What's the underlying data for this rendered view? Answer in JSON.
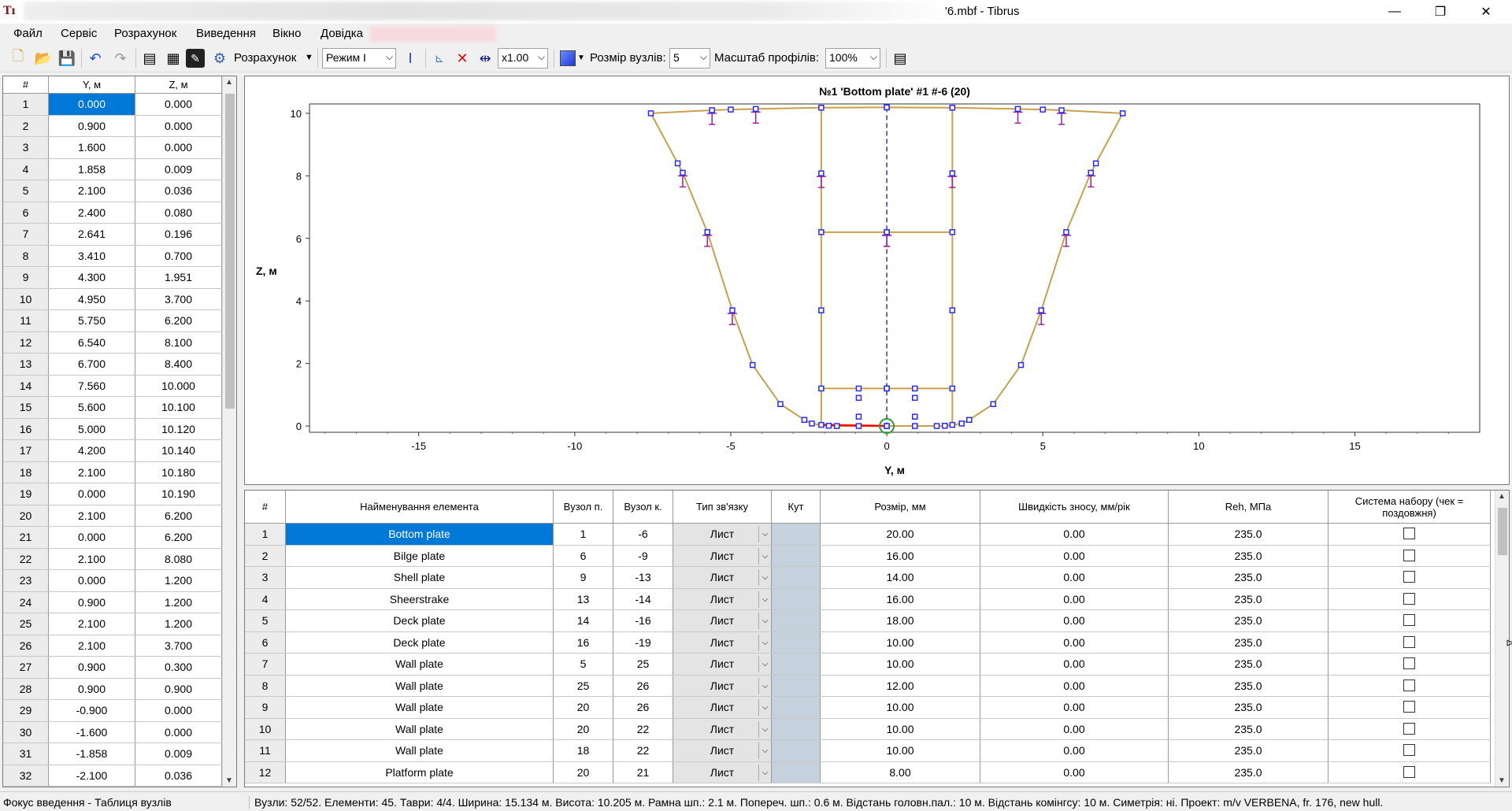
{
  "window": {
    "title": "'6.mbf - Tibrus",
    "app_icon": "tibrus-app-icon",
    "minimize": "—",
    "restore": "❐",
    "close": "✕"
  },
  "menu": [
    "Файл",
    "Сервіс",
    "Розрахунок",
    "Виведення",
    "Вікно",
    "Довідка"
  ],
  "toolbar": {
    "calc_label": "Розрахунок",
    "mode_value": "Режим I",
    "zoom_value": "x1.00",
    "node_size_label": "Розмір вузлів:",
    "node_size_value": "5",
    "profile_scale_label": "Масштаб профілів:",
    "profile_scale_value": "100%",
    "fill_color": "#1f3ad6"
  },
  "nodes_table": {
    "headers": [
      "#",
      "Y, м",
      "Z, м"
    ],
    "rows": [
      [
        "1",
        "0.000",
        "0.000"
      ],
      [
        "2",
        "0.900",
        "0.000"
      ],
      [
        "3",
        "1.600",
        "0.000"
      ],
      [
        "4",
        "1.858",
        "0.009"
      ],
      [
        "5",
        "2.100",
        "0.036"
      ],
      [
        "6",
        "2.400",
        "0.080"
      ],
      [
        "7",
        "2.641",
        "0.196"
      ],
      [
        "8",
        "3.410",
        "0.700"
      ],
      [
        "9",
        "4.300",
        "1.951"
      ],
      [
        "10",
        "4.950",
        "3.700"
      ],
      [
        "11",
        "5.750",
        "6.200"
      ],
      [
        "12",
        "6.540",
        "8.100"
      ],
      [
        "13",
        "6.700",
        "8.400"
      ],
      [
        "14",
        "7.560",
        "10.000"
      ],
      [
        "15",
        "5.600",
        "10.100"
      ],
      [
        "16",
        "5.000",
        "10.120"
      ],
      [
        "17",
        "4.200",
        "10.140"
      ],
      [
        "18",
        "2.100",
        "10.180"
      ],
      [
        "19",
        "0.000",
        "10.190"
      ],
      [
        "20",
        "2.100",
        "6.200"
      ],
      [
        "21",
        "0.000",
        "6.200"
      ],
      [
        "22",
        "2.100",
        "8.080"
      ],
      [
        "23",
        "0.000",
        "1.200"
      ],
      [
        "24",
        "0.900",
        "1.200"
      ],
      [
        "25",
        "2.100",
        "1.200"
      ],
      [
        "26",
        "2.100",
        "3.700"
      ],
      [
        "27",
        "0.900",
        "0.300"
      ],
      [
        "28",
        "0.900",
        "0.900"
      ],
      [
        "29",
        "-0.900",
        "0.000"
      ],
      [
        "30",
        "-1.600",
        "0.000"
      ],
      [
        "31",
        "-1.858",
        "0.009"
      ],
      [
        "32",
        "-2.100",
        "0.036"
      ]
    ]
  },
  "chart_data": {
    "type": "line",
    "title": "№1 'Bottom plate' #1 #-6 (20)",
    "xlabel": "Y, м",
    "ylabel": "Z, м",
    "xlim": [
      -18.5,
      19
    ],
    "ylim": [
      -0.2,
      10.3
    ],
    "xticks": [
      -15,
      -10,
      -5,
      0,
      5,
      10,
      15
    ],
    "yticks": [
      0,
      2,
      4,
      6,
      8,
      10
    ],
    "grid": false,
    "outline": [
      [
        0,
        0
      ],
      [
        0.9,
        0
      ],
      [
        1.6,
        0
      ],
      [
        1.858,
        0.009
      ],
      [
        2.1,
        0.036
      ],
      [
        2.4,
        0.08
      ],
      [
        2.641,
        0.196
      ],
      [
        3.41,
        0.7
      ],
      [
        4.3,
        1.951
      ],
      [
        4.95,
        3.7
      ],
      [
        5.75,
        6.2
      ],
      [
        6.54,
        8.1
      ],
      [
        6.7,
        8.4
      ],
      [
        7.56,
        10
      ],
      [
        5.6,
        10.1
      ],
      [
        5,
        10.12
      ],
      [
        4.2,
        10.14
      ],
      [
        2.1,
        10.18
      ],
      [
        0,
        10.19
      ]
    ],
    "inner_lines": [
      [
        [
          2.1,
          0.036
        ],
        [
          2.1,
          1.2
        ],
        [
          2.1,
          3.7
        ],
        [
          2.1,
          6.2
        ],
        [
          2.1,
          8.08
        ],
        [
          2.1,
          10.18
        ]
      ],
      [
        [
          0,
          6.2
        ],
        [
          2.1,
          6.2
        ]
      ],
      [
        [
          0,
          1.2
        ],
        [
          0.9,
          1.2
        ],
        [
          2.1,
          1.2
        ]
      ]
    ],
    "nodes": [
      [
        0,
        0
      ],
      [
        0.9,
        0
      ],
      [
        1.6,
        0
      ],
      [
        1.858,
        0.009
      ],
      [
        2.1,
        0.036
      ],
      [
        2.4,
        0.08
      ],
      [
        2.641,
        0.196
      ],
      [
        3.41,
        0.7
      ],
      [
        4.3,
        1.951
      ],
      [
        4.95,
        3.7
      ],
      [
        5.75,
        6.2
      ],
      [
        6.54,
        8.1
      ],
      [
        6.7,
        8.4
      ],
      [
        7.56,
        10
      ],
      [
        5.6,
        10.1
      ],
      [
        5,
        10.12
      ],
      [
        4.2,
        10.14
      ],
      [
        2.1,
        10.18
      ],
      [
        0,
        10.19
      ],
      [
        2.1,
        6.2
      ],
      [
        0,
        6.2
      ],
      [
        2.1,
        8.08
      ],
      [
        0,
        1.2
      ],
      [
        0.9,
        1.2
      ],
      [
        2.1,
        1.2
      ],
      [
        2.1,
        3.7
      ],
      [
        0.9,
        0.3
      ],
      [
        0.9,
        0.9
      ]
    ],
    "stiffeners": [
      [
        5.6,
        10.1
      ],
      [
        4.2,
        10.14
      ],
      [
        6.54,
        8.1
      ],
      [
        5.75,
        6.2
      ],
      [
        4.95,
        3.7
      ],
      [
        2.1,
        8.08
      ],
      [
        0,
        6.2
      ]
    ],
    "selected_element": [
      [
        0,
        0
      ],
      [
        -2.1,
        0.036
      ]
    ],
    "symmetric": true,
    "centerline_x": 0,
    "colors": {
      "outline": "#c8a04a",
      "node": "#2a2aff",
      "stiffener": "#a020a0",
      "selected": "#ff0000",
      "centerline": "#3333dd",
      "origin": "#2aa02a"
    }
  },
  "elements_table": {
    "headers": [
      "#",
      "Найменування елемента",
      "Вузол п.",
      "Вузол к.",
      "Тип зв'язку",
      "Кут",
      "Розмір, мм",
      "Швидкість зносу, мм/рік",
      "Reh, МПа",
      "Система набору (чек = поздовжня)"
    ],
    "rows": [
      [
        "1",
        "Bottom plate",
        "1",
        "-6",
        "Лист",
        "",
        "20.00",
        "0.00",
        "235.0"
      ],
      [
        "2",
        "Bilge plate",
        "6",
        "-9",
        "Лист",
        "",
        "16.00",
        "0.00",
        "235.0"
      ],
      [
        "3",
        "Shell plate",
        "9",
        "-13",
        "Лист",
        "",
        "14.00",
        "0.00",
        "235.0"
      ],
      [
        "4",
        "Sheerstrake",
        "13",
        "-14",
        "Лист",
        "",
        "16.00",
        "0.00",
        "235.0"
      ],
      [
        "5",
        "Deck plate",
        "14",
        "-16",
        "Лист",
        "",
        "18.00",
        "0.00",
        "235.0"
      ],
      [
        "6",
        "Deck plate",
        "16",
        "-19",
        "Лист",
        "",
        "10.00",
        "0.00",
        "235.0"
      ],
      [
        "7",
        "Wall plate",
        "5",
        "25",
        "Лист",
        "",
        "10.00",
        "0.00",
        "235.0"
      ],
      [
        "8",
        "Wall plate",
        "25",
        "26",
        "Лист",
        "",
        "12.00",
        "0.00",
        "235.0"
      ],
      [
        "9",
        "Wall plate",
        "20",
        "26",
        "Лист",
        "",
        "10.00",
        "0.00",
        "235.0"
      ],
      [
        "10",
        "Wall plate",
        "20",
        "22",
        "Лист",
        "",
        "10.00",
        "0.00",
        "235.0"
      ],
      [
        "11",
        "Wall plate",
        "18",
        "22",
        "Лист",
        "",
        "10.00",
        "0.00",
        "235.0"
      ],
      [
        "12",
        "Platform plate",
        "20",
        "21",
        "Лист",
        "",
        "8.00",
        "0.00",
        "235.0"
      ]
    ]
  },
  "status": {
    "focus": "Фокус введення - Таблиця вузлів",
    "summary": "Вузли: 52/52. Елементи: 45. Таври: 4/4. Ширина: 15.134 м. Висота: 10.205 м. Рамна шп.: 2.1 м. Попереч. шп.: 0.6 м. Відстань головн.пал.: 10 м. Відстань комінгсу: 10 м. Симетрія: ні. Проект: m/v VERBENA, fr. 176, new hull."
  }
}
